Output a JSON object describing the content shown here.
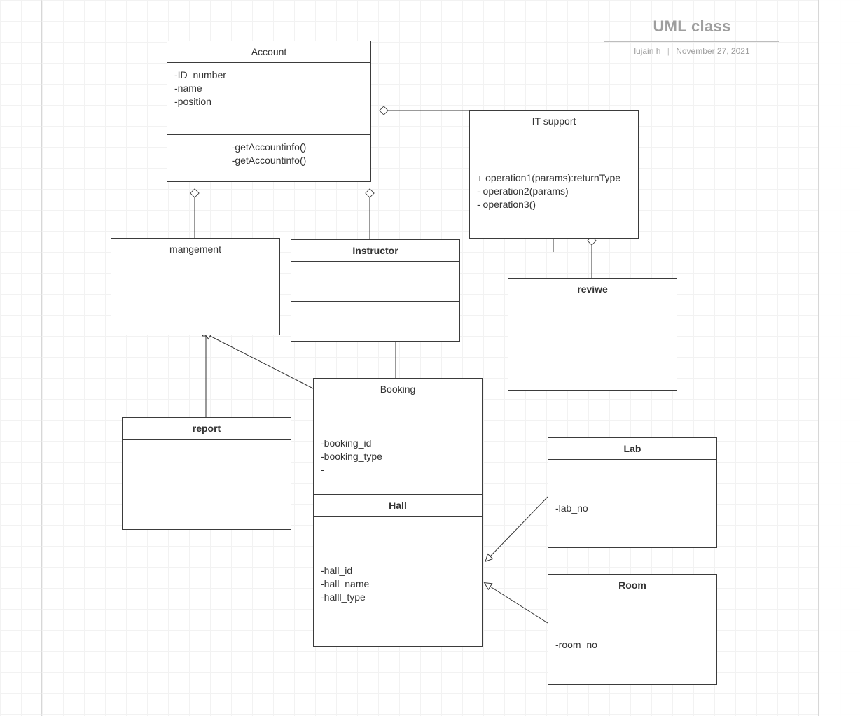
{
  "title": {
    "text": "UML class",
    "author": "lujain h",
    "date": "November 27, 2021",
    "separator": "|"
  },
  "account": {
    "name": "Account",
    "a1": "-ID_number",
    "a2": "-name",
    "a3": "-position",
    "m1": "-getAccountinfo()",
    "m2": "-getAccountinfo()"
  },
  "itsupport": {
    "name": "IT support",
    "o1": "+ operation1(params):returnType",
    "o2": "- operation2(params)",
    "o3": "- operation3()"
  },
  "management": {
    "name": "mangement"
  },
  "instructor": {
    "name": "Instructor"
  },
  "review": {
    "name": "reviwe"
  },
  "report": {
    "name": "report"
  },
  "booking": {
    "name": "Booking",
    "a1": "-booking_id",
    "a2": "-booking_type",
    "a3": "-"
  },
  "hall": {
    "name": "Hall",
    "a1": "-hall_id",
    "a2": "-hall_name",
    "a3": "-halll_type"
  },
  "lab": {
    "name": "Lab",
    "a1": "-lab_no"
  },
  "room": {
    "name": "Room",
    "a1": "-room_no"
  }
}
